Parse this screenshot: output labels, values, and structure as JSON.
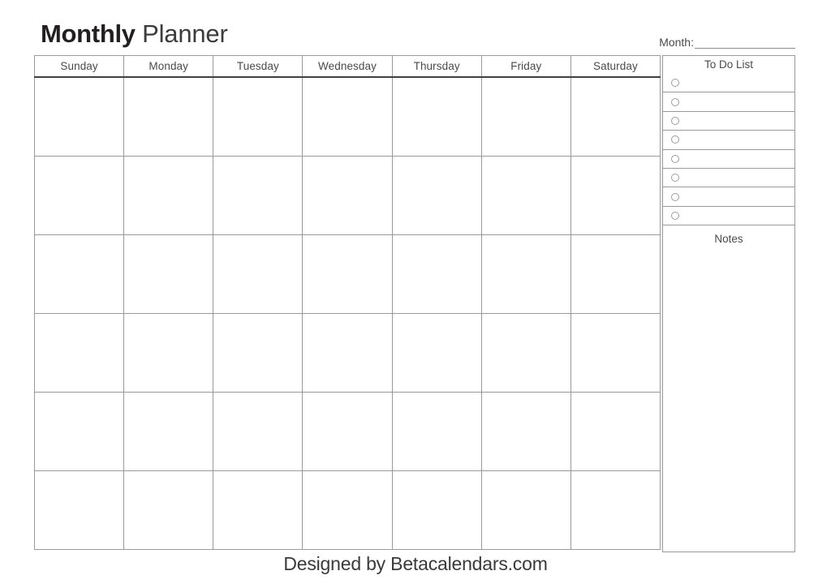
{
  "header": {
    "title_strong": "Monthly",
    "title_light": " Planner",
    "month_label": "Month:",
    "month_value": ""
  },
  "calendar": {
    "day_headers": [
      "Sunday",
      "Monday",
      "Tuesday",
      "Wednesday",
      "Thursday",
      "Friday",
      "Saturday"
    ],
    "weeks": [
      [
        "",
        "",
        "",
        "",
        "",
        "",
        ""
      ],
      [
        "",
        "",
        "",
        "",
        "",
        "",
        ""
      ],
      [
        "",
        "",
        "",
        "",
        "",
        "",
        ""
      ],
      [
        "",
        "",
        "",
        "",
        "",
        "",
        ""
      ],
      [
        "",
        "",
        "",
        "",
        "",
        "",
        ""
      ],
      [
        "",
        "",
        "",
        "",
        "",
        "",
        ""
      ]
    ]
  },
  "sidebar": {
    "todo": {
      "title": "To Do List",
      "items": [
        "",
        "",
        "",
        "",
        "",
        "",
        "",
        ""
      ]
    },
    "notes": {
      "title": "Notes",
      "content": ""
    }
  },
  "footer": {
    "credit": "Designed by Betacalendars.com"
  },
  "colors": {
    "grid_line": "#9a9a9a",
    "header_rule": "#404040",
    "text": "#4a4a4a",
    "title": "#231f20",
    "background": "#ffffff"
  }
}
